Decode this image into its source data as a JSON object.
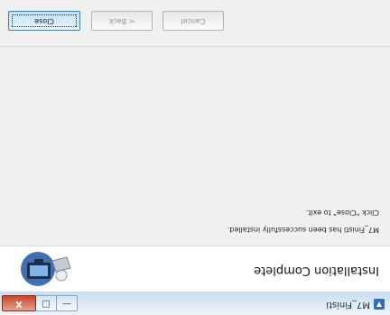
{
  "window": {
    "title": "M7_Finisti",
    "controls": {
      "minimize": "—",
      "maximize": "□",
      "close": "X"
    }
  },
  "header": {
    "heading": "Installation Complete",
    "logo_icon": "installer-computer-icon"
  },
  "body": {
    "message_success": "M7_Finisti has been successfully installed.",
    "message_instruction": "Click \"Close\" to exit."
  },
  "buttons": {
    "back": "< Back",
    "close": "Close",
    "cancel": "Cancel"
  }
}
